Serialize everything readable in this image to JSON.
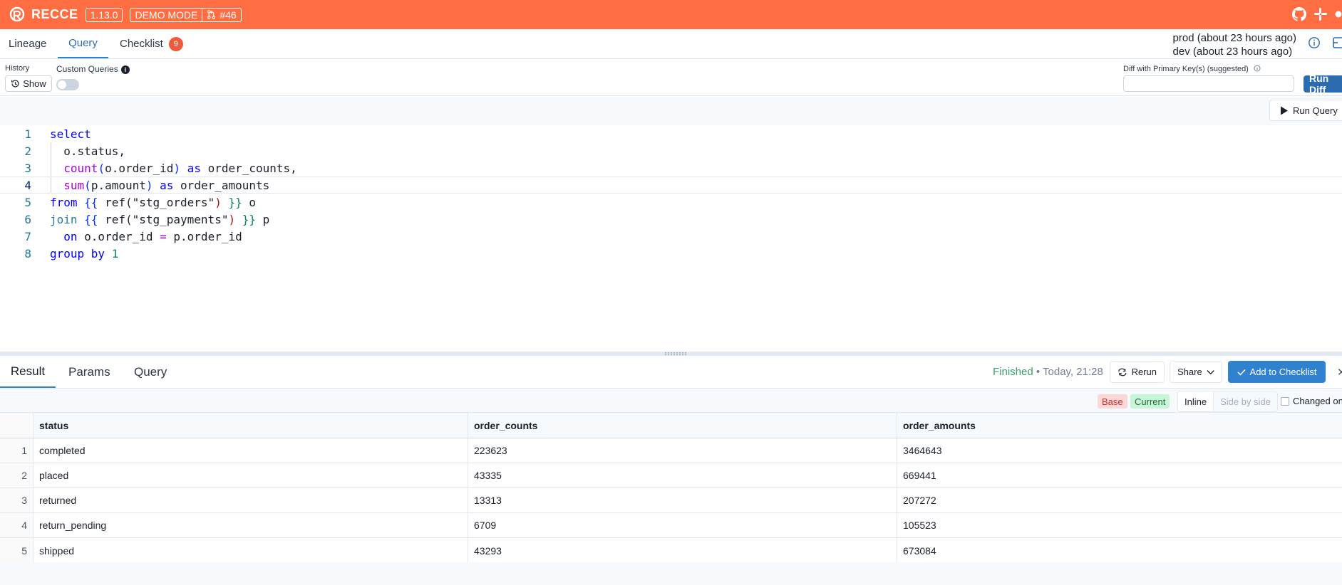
{
  "app": {
    "brand": "RECCE",
    "version": "1.13.0",
    "mode": "DEMO MODE",
    "pr": "#46",
    "colors": {
      "header": "#ff6e42",
      "accent": "#3182ce"
    }
  },
  "nav": {
    "tabs": [
      {
        "label": "Lineage"
      },
      {
        "label": "Query"
      },
      {
        "label": "Checklist",
        "count": "9"
      }
    ],
    "active": "Query",
    "env": {
      "prod": "prod (about 23 hours ago)",
      "dev": "dev (about 23 hours ago)"
    }
  },
  "options": {
    "history_label": "History",
    "show_label": "Show",
    "custom_queries_label": "Custom Queries",
    "pk_label": "Diff with Primary Key(s) (suggested)",
    "pk_value": "",
    "run_diff_label": "Run Diff"
  },
  "editor": {
    "run_query_label": "Run Query",
    "line_numbers": [
      "1",
      "2",
      "3",
      "4",
      "5",
      "6",
      "7",
      "8"
    ],
    "tokens": {
      "l1_select": "select",
      "l2": "  o.status,",
      "l3_fn": "count",
      "l3_open": "(",
      "l3_arg": "o.order_id",
      "l3_close": ")",
      "l3_as": " as ",
      "l3_rest": "order_counts,",
      "l4_fn": "sum",
      "l4_open": "(",
      "l4_arg": "p.amount",
      "l4_close": ")",
      "l4_as": " as ",
      "l4_rest": "order_amounts",
      "l5_from": "from",
      "l5_open": " {{ ",
      "l5_ref": "ref(",
      "l5_str": "\"stg_orders\"",
      "l5_rparen": ")",
      "l5_close": " }}",
      "l5_alias": " o",
      "l6_join": "join",
      "l6_open": " {{ ",
      "l6_ref": "ref(",
      "l6_str": "\"stg_payments\"",
      "l6_rparen": ")",
      "l6_close": " }}",
      "l6_alias": " p",
      "l7_on": "  on",
      "l7_left": " o.order_id ",
      "l7_eq": "=",
      "l7_right": " p.order_id",
      "l8_group": "group by ",
      "l8_num": "1"
    }
  },
  "result": {
    "tabs": [
      "Result",
      "Params",
      "Query"
    ],
    "status": "Finished",
    "time": " • Today, 21:28",
    "rerun_label": "Rerun",
    "share_label": "Share",
    "add_label": "Add to Checklist",
    "base_label": "Base",
    "current_label": "Current",
    "inline_label": "Inline",
    "side_label": "Side by side",
    "changed_only_label": "Changed only",
    "columns": [
      "status",
      "order_counts",
      "order_amounts"
    ],
    "rows": [
      [
        "1",
        "completed",
        "223623",
        "3464643"
      ],
      [
        "2",
        "placed",
        "43335",
        "669441"
      ],
      [
        "3",
        "returned",
        "13313",
        "207272"
      ],
      [
        "4",
        "return_pending",
        "6709",
        "105523"
      ],
      [
        "5",
        "shipped",
        "43293",
        "673084"
      ]
    ]
  }
}
